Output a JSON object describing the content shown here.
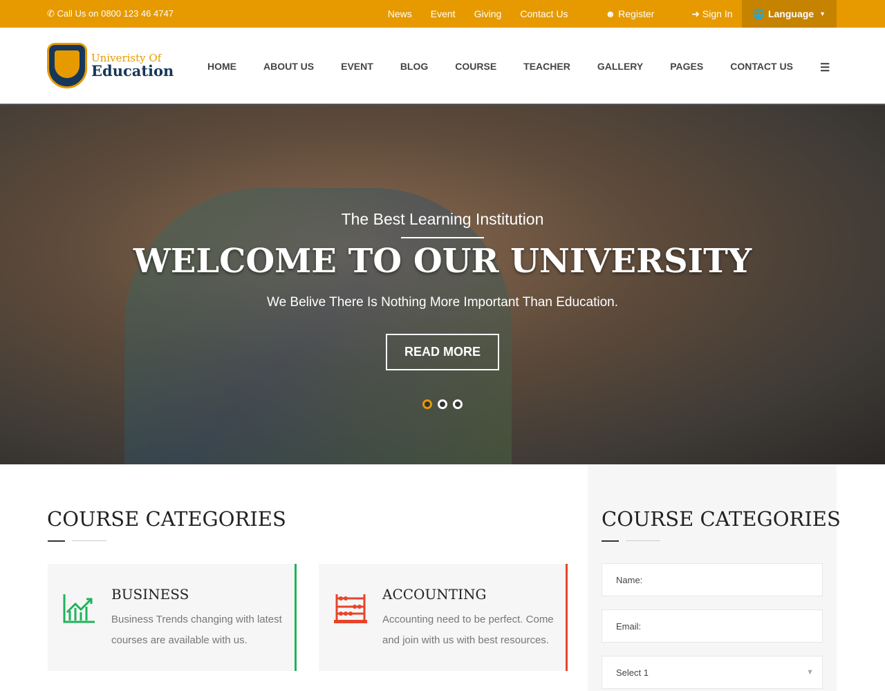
{
  "topbar": {
    "call": "Call Us on 0800 123 46 4747",
    "links": [
      "News",
      "Event",
      "Giving",
      "Contact Us",
      "Register",
      "Sign In"
    ],
    "language": "Language"
  },
  "logo": {
    "line1": "Univeristy Of",
    "line2": "Education"
  },
  "nav": [
    "HOME",
    "ABOUT US",
    "EVENT",
    "BLOG",
    "COURSE",
    "TEACHER",
    "GALLERY",
    "PAGES",
    "CONTACT US"
  ],
  "hero": {
    "subtitle": "The Best Learning Institution",
    "title": "WELCOME TO OUR UNIVERSITY",
    "description": "We Belive There Is Nothing More Important Than Education.",
    "button": "READ MORE",
    "slides": 3,
    "active_slide": 1
  },
  "main": {
    "heading": "COURSE CATEGORIES",
    "cards": [
      {
        "title": "BUSINESS",
        "text": "Business Trends changing with latest courses are available with us.",
        "icon": "chart-growth-icon",
        "color": "#1fb35a"
      },
      {
        "title": "ACCOUNTING",
        "text": "Accounting need to be perfect. Come and join with us with best resources.",
        "icon": "abacus-icon",
        "color": "#e8442a"
      }
    ]
  },
  "sidebar": {
    "heading": "COURSE CATEGORIES",
    "name_placeholder": "Name:",
    "email_placeholder": "Email:",
    "select_value": "Select 1"
  },
  "colors": {
    "accent": "#e69a00",
    "navy": "#17375a"
  }
}
